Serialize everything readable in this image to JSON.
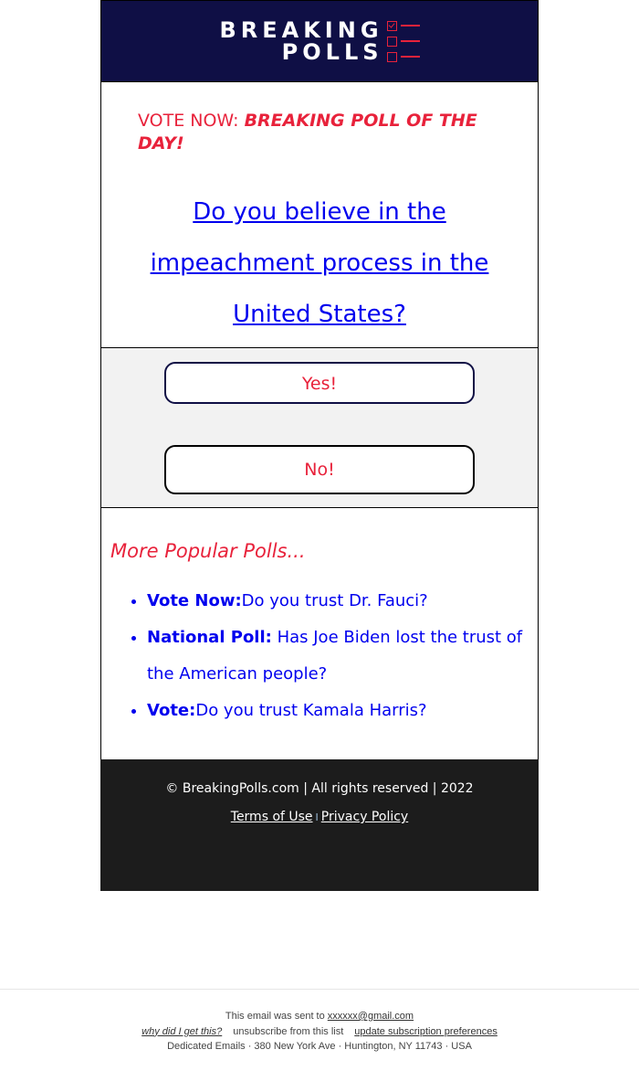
{
  "header": {
    "logo_line1": "BREAKING",
    "logo_line2": "POLLS",
    "logo_icon": "checklist-icon",
    "brand_color": "#0f0f45",
    "accent_color": "#e8223b"
  },
  "intro": {
    "kicker_prefix": "VOTE NOW: ",
    "kicker_emphasis": "BREAKING POLL OF THE DAY!"
  },
  "poll": {
    "question": "Do you believe in the impeachment process in the United States?",
    "answers": [
      {
        "label": "Yes!"
      },
      {
        "label": "No!"
      }
    ]
  },
  "more_polls": {
    "title": "More Popular Polls...",
    "items": [
      {
        "prefix": "Vote Now:",
        "text": "Do you trust Dr. Fauci?"
      },
      {
        "prefix": "National Poll:",
        "text": " Has Joe Biden lost the trust of the American people?"
      },
      {
        "prefix": "Vote:",
        "text": "Do you trust Kamala Harris?"
      }
    ]
  },
  "footer": {
    "copyright": "© BreakingPolls.com | All rights reserved | 2022",
    "terms_label": "Terms of Use",
    "separator": "I",
    "privacy_label": "Privacy Policy"
  },
  "legal": {
    "sent_to_prefix": "This email was sent to ",
    "sent_to_email": "xxxxxx@gmail.com",
    "why_label": "why did I get this?",
    "unsubscribe_label": "unsubscribe from this list",
    "preferences_label": "update subscription preferences",
    "address": "Dedicated Emails · 380 New York Ave · Huntington, NY 11743 · USA"
  }
}
